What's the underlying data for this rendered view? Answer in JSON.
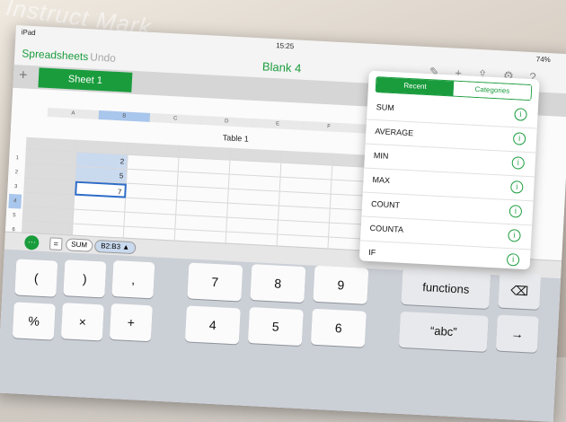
{
  "watermark": "Instruct Mark",
  "status": {
    "carrier": "iPad",
    "time": "15:25",
    "battery": "74%"
  },
  "toolbar": {
    "spreadsheets_label": "Spreadsheets",
    "undo_label": "Undo",
    "doc_title": "Blank 4"
  },
  "sheet_tabs": {
    "add_icon": "+",
    "active_tab": "Sheet 1"
  },
  "table": {
    "title": "Table 1",
    "columns": [
      "A",
      "B",
      "C",
      "D",
      "E",
      "F",
      "G"
    ],
    "selected_column": "B",
    "row_numbers": [
      "1",
      "2",
      "3",
      "4",
      "5",
      "6",
      "7"
    ],
    "selected_row": "4",
    "values": {
      "B2": "2",
      "B3": "5",
      "B4": "7"
    }
  },
  "formula_bar": {
    "more_glyph": "···",
    "eq_glyph": "=",
    "function": "SUM",
    "range": "B2:B3 ▲"
  },
  "popover": {
    "tabs": {
      "recent": "Recent",
      "categories": "Categories"
    },
    "functions": [
      "SUM",
      "AVERAGE",
      "MIN",
      "MAX",
      "COUNT",
      "COUNTA",
      "IF"
    ],
    "info_glyph": "i"
  },
  "keyboard": {
    "row1": [
      "(",
      ")",
      ",",
      "7",
      "8",
      "9",
      "functions",
      "⌫"
    ],
    "row2": [
      "%",
      "×",
      "+",
      "4",
      "5",
      "6",
      "“abc”",
      "→"
    ]
  }
}
